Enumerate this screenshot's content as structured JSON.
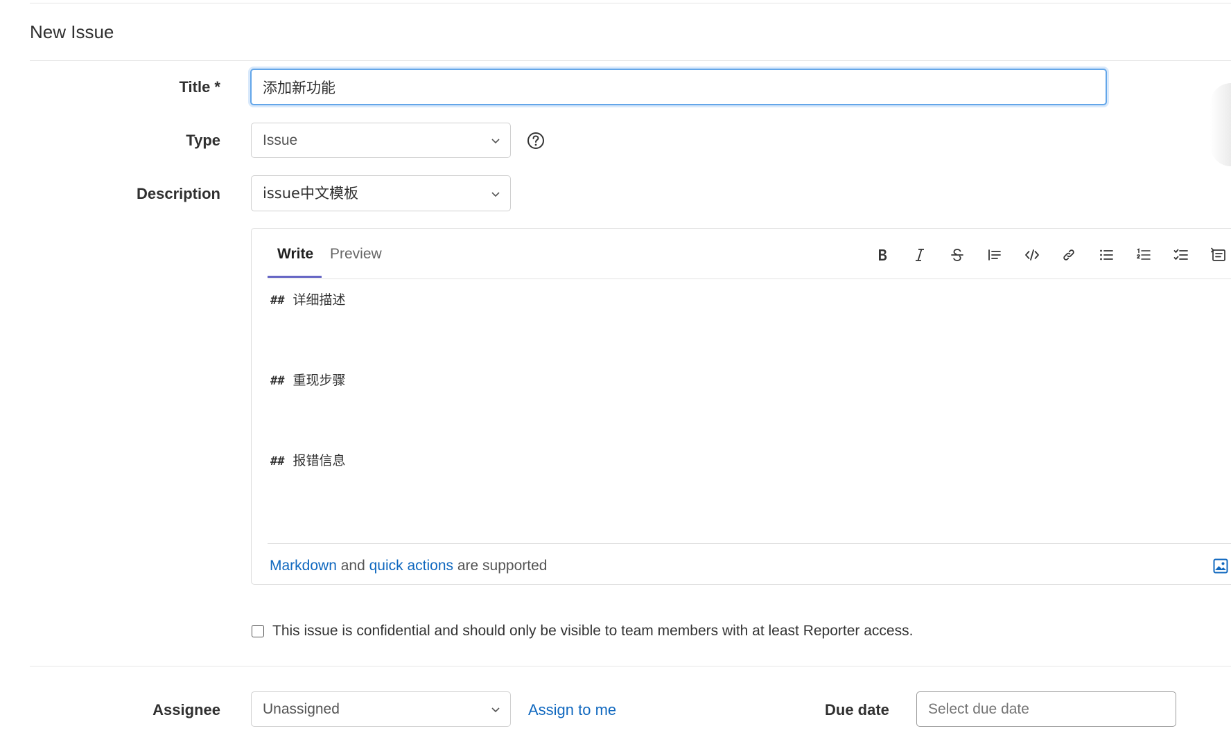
{
  "header": {
    "title": "New Issue"
  },
  "form": {
    "title": {
      "label": "Title *",
      "value": "添加新功能"
    },
    "type": {
      "label": "Type",
      "value": "Issue"
    },
    "description": {
      "label": "Description",
      "template_value": "issue中文模板"
    },
    "editor": {
      "tabs": [
        {
          "label": "Write"
        },
        {
          "label": "Preview"
        }
      ],
      "toolbar_icons": [
        "bold-icon",
        "italic-icon",
        "strikethrough-icon",
        "quote-icon",
        "code-icon",
        "link-icon",
        "bullet-list-icon",
        "numbered-list-icon",
        "task-list-icon",
        "collapsible-icon"
      ],
      "lines": [
        {
          "hash": "##",
          "text": "详细描述"
        },
        {
          "hash": "##",
          "text": "重现步骤"
        },
        {
          "hash": "##",
          "text": "报错信息"
        }
      ],
      "footer": {
        "markdown": "Markdown",
        "and": "and",
        "quick_actions": "quick actions",
        "supported": "are supported"
      }
    },
    "confidential": {
      "label": "This issue is confidential and should only be visible to team members with at least Reporter access.",
      "checked": false
    },
    "assignee": {
      "label": "Assignee",
      "value": "Unassigned",
      "assign_to_me": "Assign to me"
    },
    "due_date": {
      "label": "Due date",
      "placeholder": "Select due date"
    }
  },
  "colors": {
    "link": "#1068bf",
    "focus": "#63a6e9",
    "tab_accent": "#6666c4"
  }
}
